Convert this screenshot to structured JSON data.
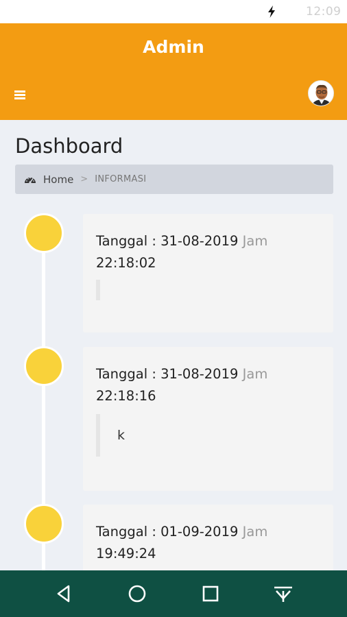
{
  "status_bar": {
    "time": "12:09",
    "icons": [
      "charging-bolt-icon"
    ]
  },
  "app_bar": {
    "title": "Admin",
    "menu_icon": "hamburger-menu-icon",
    "avatar_icon": "user-avatar"
  },
  "page": {
    "title": "Dashboard"
  },
  "breadcrumb": {
    "icon": "dashboard-gauge-icon",
    "home": "Home",
    "separator": ">",
    "current": "INFORMASI"
  },
  "timeline": [
    {
      "date_label": "Tanggal : 31-08-2019",
      "jam_label": "Jam",
      "time": "22:18:02",
      "message": ""
    },
    {
      "date_label": "Tanggal : 31-08-2019",
      "jam_label": "Jam",
      "time": "22:18:16",
      "message": "k"
    },
    {
      "date_label": "Tanggal : 01-09-2019",
      "jam_label": "Jam",
      "time": "19:49:24",
      "message": ""
    }
  ],
  "nav_bar": {
    "buttons": [
      "back-icon",
      "home-icon",
      "recents-icon",
      "keyboard-hide-icon"
    ]
  },
  "colors": {
    "app_bar": "#f39c12",
    "background": "#edf0f5",
    "timeline_dot": "#f9d23a",
    "nav_bar": "#0f5043",
    "breadcrumb": "#d2d6de"
  }
}
